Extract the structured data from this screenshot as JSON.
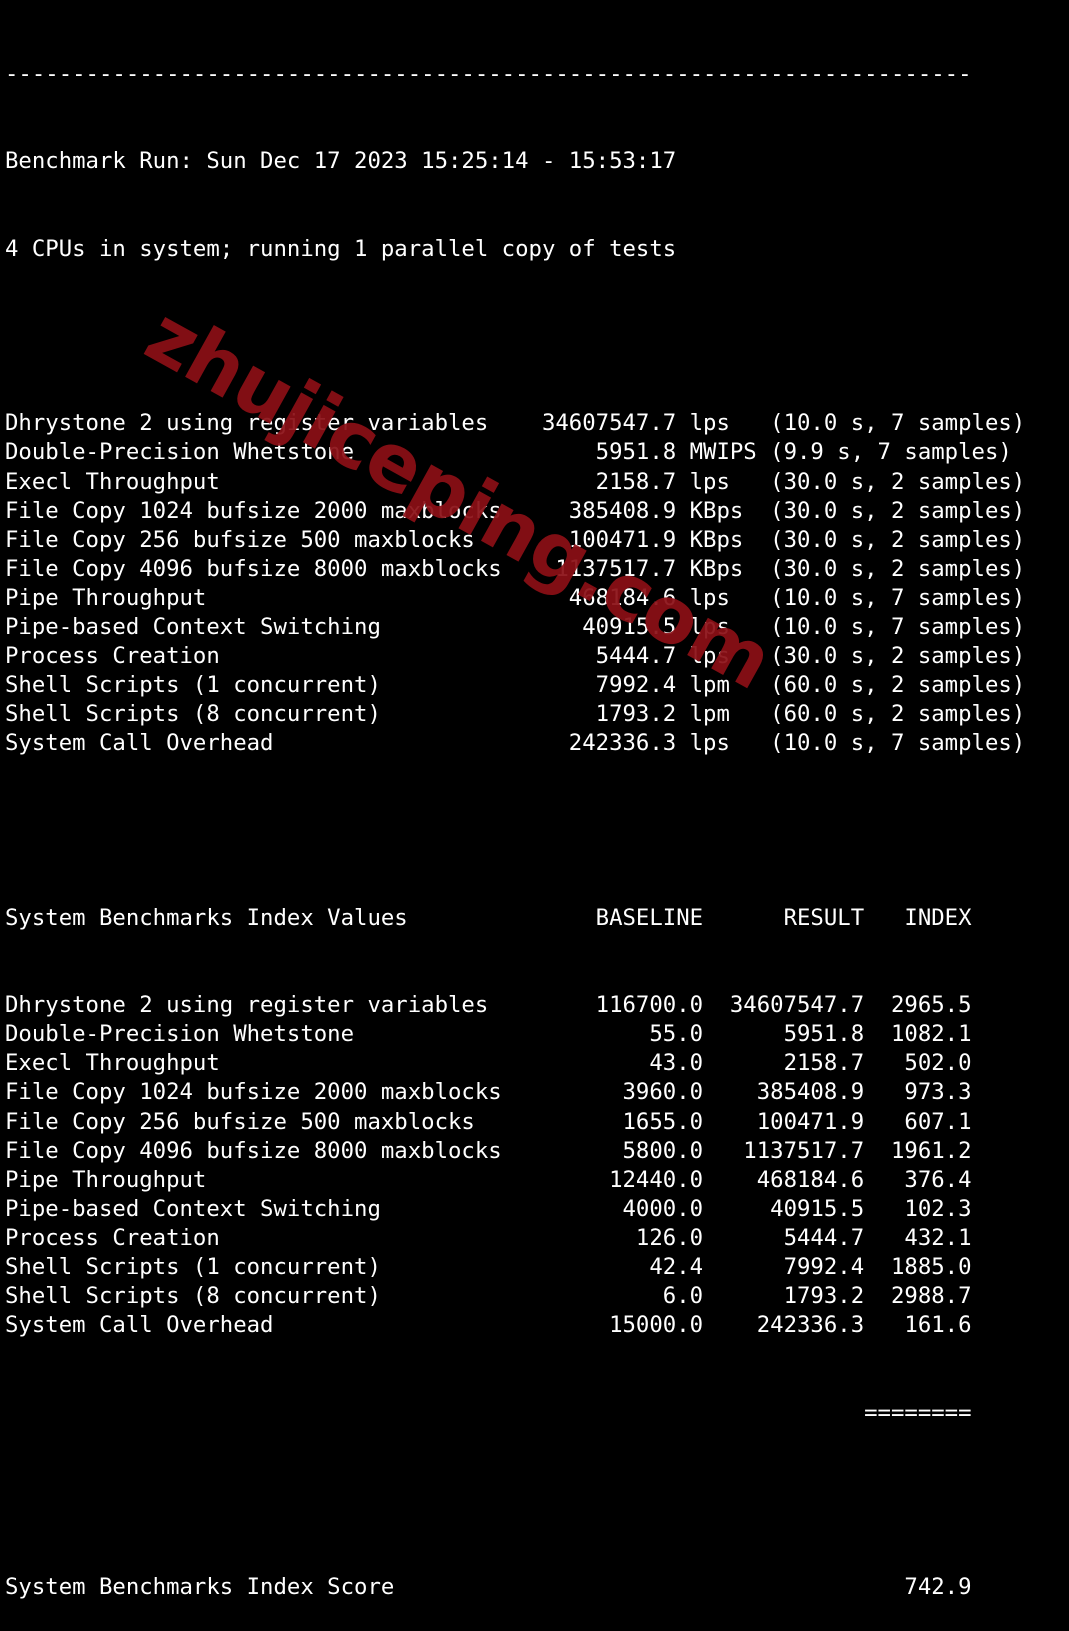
{
  "terminal": {
    "background_color": "#000000",
    "text_color": "#ffffff",
    "separator_line": "------------------------------------------------------------------------",
    "header": {
      "benchmark_run": "Benchmark Run: Sun Dec 17 2023 15:25:14 - 15:53:17",
      "cpu_line": "4 CPUs in system; running 1 parallel copy of tests"
    },
    "raw_results": [
      {
        "name": "Dhrystone 2 using register variables",
        "value": "34607547.7",
        "unit": "lps",
        "timing": "(10.0 s, 7 samples)"
      },
      {
        "name": "Double-Precision Whetstone",
        "value": "5951.8",
        "unit": "MWIPS",
        "timing": "(9.9 s, 7 samples)"
      },
      {
        "name": "Execl Throughput",
        "value": "2158.7",
        "unit": "lps",
        "timing": "(30.0 s, 2 samples)"
      },
      {
        "name": "File Copy 1024 bufsize 2000 maxblocks",
        "value": "385408.9",
        "unit": "KBps",
        "timing": "(30.0 s, 2 samples)"
      },
      {
        "name": "File Copy 256 bufsize 500 maxblocks",
        "value": "100471.9",
        "unit": "KBps",
        "timing": "(30.0 s, 2 samples)"
      },
      {
        "name": "File Copy 4096 bufsize 8000 maxblocks",
        "value": "1137517.7",
        "unit": "KBps",
        "timing": "(30.0 s, 2 samples)"
      },
      {
        "name": "Pipe Throughput",
        "value": "468184.6",
        "unit": "lps",
        "timing": "(10.0 s, 7 samples)"
      },
      {
        "name": "Pipe-based Context Switching",
        "value": "40915.5",
        "unit": "lps",
        "timing": "(10.0 s, 7 samples)"
      },
      {
        "name": "Process Creation",
        "value": "5444.7",
        "unit": "lps",
        "timing": "(30.0 s, 2 samples)"
      },
      {
        "name": "Shell Scripts (1 concurrent)",
        "value": "7992.4",
        "unit": "lpm",
        "timing": "(60.0 s, 2 samples)"
      },
      {
        "name": "Shell Scripts (8 concurrent)",
        "value": "1793.2",
        "unit": "lpm",
        "timing": "(60.0 s, 2 samples)"
      },
      {
        "name": "System Call Overhead",
        "value": "242336.3",
        "unit": "lps",
        "timing": "(10.0 s, 7 samples)"
      }
    ],
    "index_table": {
      "title": "System Benchmarks Index Values",
      "columns": [
        "BASELINE",
        "RESULT",
        "INDEX"
      ],
      "rows": [
        {
          "name": "Dhrystone 2 using register variables",
          "baseline": "116700.0",
          "result": "34607547.7",
          "index": "2965.5"
        },
        {
          "name": "Double-Precision Whetstone",
          "baseline": "55.0",
          "result": "5951.8",
          "index": "1082.1"
        },
        {
          "name": "Execl Throughput",
          "baseline": "43.0",
          "result": "2158.7",
          "index": "502.0"
        },
        {
          "name": "File Copy 1024 bufsize 2000 maxblocks",
          "baseline": "3960.0",
          "result": "385408.9",
          "index": "973.3"
        },
        {
          "name": "File Copy 256 bufsize 500 maxblocks",
          "baseline": "1655.0",
          "result": "100471.9",
          "index": "607.1"
        },
        {
          "name": "File Copy 4096 bufsize 8000 maxblocks",
          "baseline": "5800.0",
          "result": "1137517.7",
          "index": "1961.2"
        },
        {
          "name": "Pipe Throughput",
          "baseline": "12440.0",
          "result": "468184.6",
          "index": "376.4"
        },
        {
          "name": "Pipe-based Context Switching",
          "baseline": "4000.0",
          "result": "40915.5",
          "index": "102.3"
        },
        {
          "name": "Process Creation",
          "baseline": "126.0",
          "result": "5444.7",
          "index": "432.1"
        },
        {
          "name": "Shell Scripts (1 concurrent)",
          "baseline": "42.4",
          "result": "7992.4",
          "index": "1885.0"
        },
        {
          "name": "Shell Scripts (8 concurrent)",
          "baseline": "6.0",
          "result": "1793.2",
          "index": "2988.7"
        },
        {
          "name": "System Call Overhead",
          "baseline": "15000.0",
          "result": "242336.3",
          "index": "161.6"
        }
      ],
      "total_rule": "========",
      "score_label": "System Benchmarks Index Score",
      "score_value": "742.9"
    }
  },
  "watermark": {
    "text": "zhujiceping.com",
    "color": "#8b1016"
  }
}
